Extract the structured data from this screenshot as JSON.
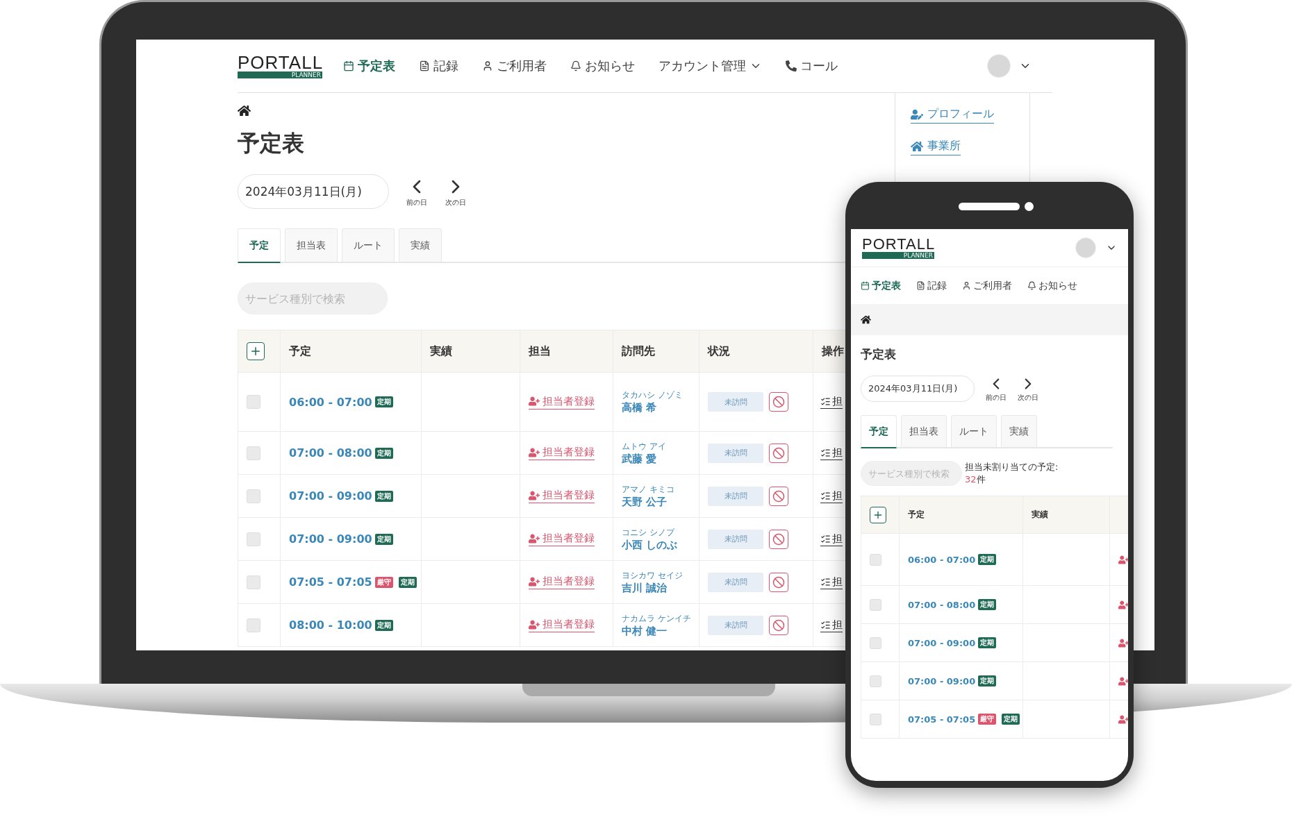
{
  "laptop": {
    "brand": {
      "name": "PORTALL",
      "sub": "PLANNER"
    },
    "nav": [
      {
        "label": "予定表",
        "selected": true,
        "dropdown": false
      },
      {
        "label": "記録",
        "selected": false,
        "dropdown": false
      },
      {
        "label": "ご利用者",
        "selected": false,
        "dropdown": false
      },
      {
        "label": "お知らせ",
        "selected": false,
        "dropdown": false
      },
      {
        "label": "アカウント管理",
        "selected": false,
        "dropdown": true
      },
      {
        "label": "コール",
        "selected": false,
        "dropdown": false
      }
    ],
    "sidebar_links": [
      "プロフィール",
      "事業所"
    ],
    "title": "予定表",
    "date": "2024年03月11日(月)",
    "prev_label": "前の日",
    "next_label": "次の日",
    "tabs": [
      {
        "label": "予定",
        "selected": true
      },
      {
        "label": "担当表",
        "selected": false
      },
      {
        "label": "ルート",
        "selected": false
      },
      {
        "label": "実績",
        "selected": false
      }
    ],
    "search": {
      "placeholder": "サービス種別で検索"
    },
    "table": {
      "columns": [
        "予定",
        "実績",
        "担当",
        "訪問先",
        "状況",
        "操作"
      ],
      "rows": [
        {
          "checked": false,
          "time": "06:00 - 07:00",
          "tags": [
            {
              "label": "定期",
              "color": "#1e6a55"
            }
          ],
          "assign": "担当者登録",
          "kana": "タカハシ ノゾミ",
          "name": "高橋 希",
          "status": "未訪問",
          "operation": "担"
        },
        {
          "checked": false,
          "time": "07:00 - 08:00",
          "tags": [
            {
              "label": "定期",
              "color": "#1e6a55"
            }
          ],
          "assign": "担当者登録",
          "kana": "ムトウ アイ",
          "name": "武藤 愛",
          "status": "未訪問",
          "operation": "担"
        },
        {
          "checked": false,
          "time": "07:00 - 09:00",
          "tags": [
            {
              "label": "定期",
              "color": "#1e6a55"
            }
          ],
          "assign": "担当者登録",
          "kana": "アマノ キミコ",
          "name": "天野 公子",
          "status": "未訪問",
          "operation": "担"
        },
        {
          "checked": false,
          "time": "07:00 - 09:00",
          "tags": [
            {
              "label": "定期",
              "color": "#1e6a55"
            }
          ],
          "assign": "担当者登録",
          "kana": "コニシ シノブ",
          "name": "小西 しのぶ",
          "status": "未訪問",
          "operation": "担"
        },
        {
          "checked": false,
          "time": "07:05 - 07:05",
          "tags": [
            {
              "label": "厳守",
              "color": "#d9566e"
            },
            {
              "label": "定期",
              "color": "#1e6a55"
            }
          ],
          "assign": "担当者登録",
          "kana": "ヨシカワ セイジ",
          "name": "吉川 誠治",
          "status": "未訪問",
          "operation": "担"
        },
        {
          "checked": false,
          "time": "08:00 - 10:00",
          "tags": [
            {
              "label": "定期",
              "color": "#1e6a55"
            }
          ],
          "assign": "担当者登録",
          "kana": "ナカムラ ケンイチ",
          "name": "中村 健一",
          "status": "未訪問",
          "operation": "担"
        }
      ]
    }
  },
  "phone": {
    "brand": {
      "name": "PORTALL",
      "sub": "PLANNER"
    },
    "nav": [
      {
        "label": "予定表",
        "selected": true
      },
      {
        "label": "記録",
        "selected": false
      },
      {
        "label": "ご利用者",
        "selected": false
      },
      {
        "label": "お知らせ",
        "selected": false
      }
    ],
    "title": "予定表",
    "date": "2024年03月11日(月)",
    "prev_label": "前の日",
    "next_label": "次の日",
    "tabs": [
      {
        "label": "予定",
        "selected": true
      },
      {
        "label": "担当表",
        "selected": false
      },
      {
        "label": "ルート",
        "selected": false
      },
      {
        "label": "実績",
        "selected": false
      }
    ],
    "search": {
      "placeholder": "サービス種別で検索"
    },
    "unassigned": {
      "label": "担当未割り当ての予定:",
      "count": "32",
      "unit": "件"
    },
    "table": {
      "columns": [
        "予定",
        "実績"
      ],
      "rows": [
        {
          "checked": false,
          "time": "06:00 - 07:00",
          "tags": [
            {
              "label": "定期",
              "color": "#1e6a55"
            }
          ]
        },
        {
          "checked": false,
          "time": "07:00 - 08:00",
          "tags": [
            {
              "label": "定期",
              "color": "#1e6a55"
            }
          ]
        },
        {
          "checked": false,
          "time": "07:00 - 09:00",
          "tags": [
            {
              "label": "定期",
              "color": "#1e6a55"
            }
          ]
        },
        {
          "checked": false,
          "time": "07:00 - 09:00",
          "tags": [
            {
              "label": "定期",
              "color": "#1e6a55"
            }
          ]
        },
        {
          "checked": false,
          "time": "07:05 - 07:05",
          "tags": [
            {
              "label": "厳守",
              "color": "#d9566e"
            },
            {
              "label": "定期",
              "color": "#1e6a55"
            }
          ]
        }
      ]
    }
  }
}
